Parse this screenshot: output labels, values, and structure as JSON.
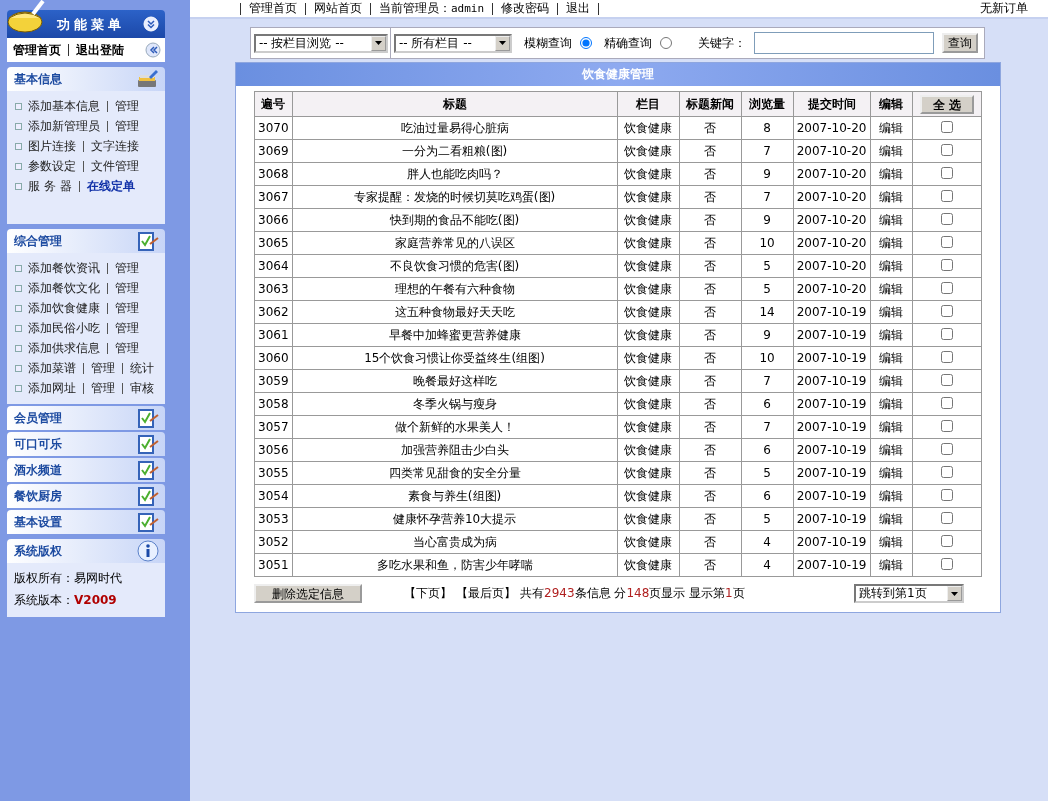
{
  "sidebar": {
    "title": "功能菜单",
    "top_links": [
      "管理首页",
      "退出登陆"
    ],
    "sections": [
      {
        "title": "基本信息",
        "kind": "links",
        "expanded": true,
        "rows": [
          {
            "links": [
              "添加基本信息",
              "管理"
            ],
            "highlight": false
          },
          {
            "links": [
              "添加新管理员",
              "管理"
            ],
            "highlight": false
          },
          {
            "links": [
              "图片连接",
              "文字连接"
            ],
            "highlight": false
          },
          {
            "links": [
              "参数设定",
              "文件管理"
            ],
            "highlight": false
          },
          {
            "links": [
              "服 务 器",
              "在线定单"
            ],
            "highlight": true
          }
        ]
      },
      {
        "title": "综合管理",
        "kind": "links",
        "expanded": true,
        "rows": [
          {
            "links": [
              "添加餐饮资讯",
              "管理"
            ],
            "highlight": false
          },
          {
            "links": [
              "添加餐饮文化",
              "管理"
            ],
            "highlight": false
          },
          {
            "links": [
              "添加饮食健康",
              "管理"
            ],
            "highlight": false
          },
          {
            "links": [
              "添加民俗小吃",
              "管理"
            ],
            "highlight": false
          },
          {
            "links": [
              "添加供求信息",
              "管理"
            ],
            "highlight": false
          },
          {
            "links": [
              "添加菜谱",
              "管理",
              "统计"
            ],
            "highlight": false
          },
          {
            "links": [
              "添加网址",
              "管理",
              "审核"
            ],
            "highlight": false
          }
        ]
      },
      {
        "title": "会员管理",
        "kind": "links",
        "expanded": false
      },
      {
        "title": "可口可乐",
        "kind": "links",
        "expanded": false
      },
      {
        "title": "酒水频道",
        "kind": "links",
        "expanded": false
      },
      {
        "title": "餐饮厨房",
        "kind": "links",
        "expanded": false
      },
      {
        "title": "基本设置",
        "kind": "links",
        "expanded": false
      },
      {
        "title": "系统版权",
        "kind": "info",
        "expanded": true,
        "lines": [
          {
            "label": "版权所有：",
            "value": "易网时代",
            "emphasis": false
          },
          {
            "label": "系统版本：",
            "value": "V2009",
            "emphasis": true
          }
        ]
      }
    ]
  },
  "top_bar": {
    "links": [
      "管理首页",
      "网站首页"
    ],
    "admin_label": "当前管理员：",
    "admin_name": "admin",
    "links_after": [
      "修改密码",
      "退出"
    ],
    "notice": "无新订单"
  },
  "search": {
    "browse_select": "-- 按栏目浏览 --",
    "column_select": "-- 所有栏目 --",
    "modes": [
      {
        "label": "模糊查询",
        "selected": true
      },
      {
        "label": "精确查询",
        "selected": false
      }
    ],
    "keyword_label": "关键字：",
    "button": "查询"
  },
  "panel": {
    "title": "饮食健康管理",
    "table": {
      "columns": [
        "遍号",
        "标题",
        "栏目",
        "标题新闻",
        "浏览量",
        "提交时间",
        "编辑"
      ],
      "select_all": "全 选",
      "rows": [
        {
          "id": "3070",
          "title": "吃油过量易得心脏病",
          "column": "饮食健康",
          "headline": "否",
          "views": "8",
          "date": "2007-10-20",
          "edit": "编辑",
          "checked": false
        },
        {
          "id": "3069",
          "title": "一分为二看粗粮(图)",
          "column": "饮食健康",
          "headline": "否",
          "views": "7",
          "date": "2007-10-20",
          "edit": "编辑",
          "checked": false
        },
        {
          "id": "3068",
          "title": "胖人也能吃肉吗？",
          "column": "饮食健康",
          "headline": "否",
          "views": "9",
          "date": "2007-10-20",
          "edit": "编辑",
          "checked": false
        },
        {
          "id": "3067",
          "title": "专家提醒：发烧的时候切莫吃鸡蛋(图)",
          "column": "饮食健康",
          "headline": "否",
          "views": "7",
          "date": "2007-10-20",
          "edit": "编辑",
          "checked": false
        },
        {
          "id": "3066",
          "title": "快到期的食品不能吃(图)",
          "column": "饮食健康",
          "headline": "否",
          "views": "9",
          "date": "2007-10-20",
          "edit": "编辑",
          "checked": false
        },
        {
          "id": "3065",
          "title": "家庭营养常见的八误区",
          "column": "饮食健康",
          "headline": "否",
          "views": "10",
          "date": "2007-10-20",
          "edit": "编辑",
          "checked": false
        },
        {
          "id": "3064",
          "title": "不良饮食习惯的危害(图)",
          "column": "饮食健康",
          "headline": "否",
          "views": "5",
          "date": "2007-10-20",
          "edit": "编辑",
          "checked": false
        },
        {
          "id": "3063",
          "title": "理想的午餐有六种食物",
          "column": "饮食健康",
          "headline": "否",
          "views": "5",
          "date": "2007-10-20",
          "edit": "编辑",
          "checked": false
        },
        {
          "id": "3062",
          "title": "这五种食物最好天天吃",
          "column": "饮食健康",
          "headline": "否",
          "views": "14",
          "date": "2007-10-19",
          "edit": "编辑",
          "checked": false
        },
        {
          "id": "3061",
          "title": "早餐中加蜂蜜更营养健康",
          "column": "饮食健康",
          "headline": "否",
          "views": "9",
          "date": "2007-10-19",
          "edit": "编辑",
          "checked": false
        },
        {
          "id": "3060",
          "title": "15个饮食习惯让你受益终生(组图)",
          "column": "饮食健康",
          "headline": "否",
          "views": "10",
          "date": "2007-10-19",
          "edit": "编辑",
          "checked": false
        },
        {
          "id": "3059",
          "title": "晚餐最好这样吃",
          "column": "饮食健康",
          "headline": "否",
          "views": "7",
          "date": "2007-10-19",
          "edit": "编辑",
          "checked": false
        },
        {
          "id": "3058",
          "title": "冬季火锅与瘦身",
          "column": "饮食健康",
          "headline": "否",
          "views": "6",
          "date": "2007-10-19",
          "edit": "编辑",
          "checked": false
        },
        {
          "id": "3057",
          "title": "做个新鲜的水果美人！",
          "column": "饮食健康",
          "headline": "否",
          "views": "7",
          "date": "2007-10-19",
          "edit": "编辑",
          "checked": false
        },
        {
          "id": "3056",
          "title": "加强营养阻击少白头",
          "column": "饮食健康",
          "headline": "否",
          "views": "6",
          "date": "2007-10-19",
          "edit": "编辑",
          "checked": false
        },
        {
          "id": "3055",
          "title": "四类常见甜食的安全分量",
          "column": "饮食健康",
          "headline": "否",
          "views": "5",
          "date": "2007-10-19",
          "edit": "编辑",
          "checked": false
        },
        {
          "id": "3054",
          "title": "素食与养生(组图)",
          "column": "饮食健康",
          "headline": "否",
          "views": "6",
          "date": "2007-10-19",
          "edit": "编辑",
          "checked": false
        },
        {
          "id": "3053",
          "title": "健康怀孕营养10大提示",
          "column": "饮食健康",
          "headline": "否",
          "views": "5",
          "date": "2007-10-19",
          "edit": "编辑",
          "checked": false
        },
        {
          "id": "3052",
          "title": "当心富贵成为病",
          "column": "饮食健康",
          "headline": "否",
          "views": "4",
          "date": "2007-10-19",
          "edit": "编辑",
          "checked": false
        },
        {
          "id": "3051",
          "title": "多吃水果和鱼，防害少年哮喘",
          "column": "饮食健康",
          "headline": "否",
          "views": "4",
          "date": "2007-10-19",
          "edit": "编辑",
          "checked": false
        }
      ]
    },
    "delete_button": "删除选定信息",
    "pager_links": [
      "【下页】",
      "【最后页】"
    ],
    "summary": [
      {
        "text": "共有",
        "kind": "plain"
      },
      {
        "text": "2943",
        "kind": "number"
      },
      {
        "text": "条信息 分",
        "kind": "plain"
      },
      {
        "text": "148",
        "kind": "number"
      },
      {
        "text": "页显示 显示第",
        "kind": "plain"
      },
      {
        "text": "1",
        "kind": "number"
      },
      {
        "text": "页",
        "kind": "plain"
      }
    ],
    "jump_select": "跳转到第1页"
  }
}
